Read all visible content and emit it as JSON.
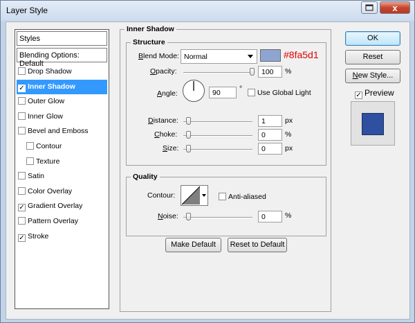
{
  "window": {
    "title": "Layer Style",
    "help_icon": "restore-icon",
    "close_icon": "close-icon",
    "close_label": "x"
  },
  "styles_list": {
    "header": "Styles",
    "blending": "Blending Options: Default",
    "items": [
      {
        "label": "Drop Shadow",
        "checked": false,
        "selected": false,
        "sub": false
      },
      {
        "label": "Inner Shadow",
        "checked": true,
        "selected": true,
        "sub": false
      },
      {
        "label": "Outer Glow",
        "checked": false,
        "selected": false,
        "sub": false
      },
      {
        "label": "Inner Glow",
        "checked": false,
        "selected": false,
        "sub": false
      },
      {
        "label": "Bevel and Emboss",
        "checked": false,
        "selected": false,
        "sub": false
      },
      {
        "label": "Contour",
        "checked": false,
        "selected": false,
        "sub": true
      },
      {
        "label": "Texture",
        "checked": false,
        "selected": false,
        "sub": true
      },
      {
        "label": "Satin",
        "checked": false,
        "selected": false,
        "sub": false
      },
      {
        "label": "Color Overlay",
        "checked": false,
        "selected": false,
        "sub": false
      },
      {
        "label": "Gradient Overlay",
        "checked": true,
        "selected": false,
        "sub": false
      },
      {
        "label": "Pattern Overlay",
        "checked": false,
        "selected": false,
        "sub": false
      },
      {
        "label": "Stroke",
        "checked": true,
        "selected": false,
        "sub": false
      }
    ]
  },
  "inner_shadow": {
    "section_title": "Inner Shadow",
    "structure": {
      "title": "Structure",
      "blend_mode_label": "Blend Mode:",
      "blend_mode_value": "Normal",
      "color": "#8fa5d1",
      "color_annotation": "#8fa5d1",
      "opacity_label": "Opacity:",
      "opacity_value": "100",
      "opacity_fraction": 1.0,
      "percent": "%",
      "angle_label": "Angle:",
      "angle_value": "90",
      "degree": "°",
      "global_light_label": "Use Global Light",
      "global_light_checked": false,
      "distance_label": "Distance:",
      "distance_value": "1",
      "distance_fraction": 0.0,
      "choke_label": "Choke:",
      "choke_value": "0",
      "choke_fraction": 0.0,
      "size_label": "Size:",
      "size_value": "0",
      "size_fraction": 0.0,
      "px": "px"
    },
    "quality": {
      "title": "Quality",
      "contour_label": "Contour:",
      "anti_aliased_label": "Anti-aliased",
      "anti_aliased_checked": false,
      "noise_label": "Noise:",
      "noise_value": "0",
      "noise_fraction": 0.0,
      "percent": "%"
    },
    "make_default": "Make Default",
    "reset_default": "Reset to Default"
  },
  "actions": {
    "ok": "OK",
    "reset": "Reset",
    "new_style": "New Style...",
    "preview_label": "Preview",
    "preview_checked": true,
    "preview_color": "#2f4fa0"
  }
}
